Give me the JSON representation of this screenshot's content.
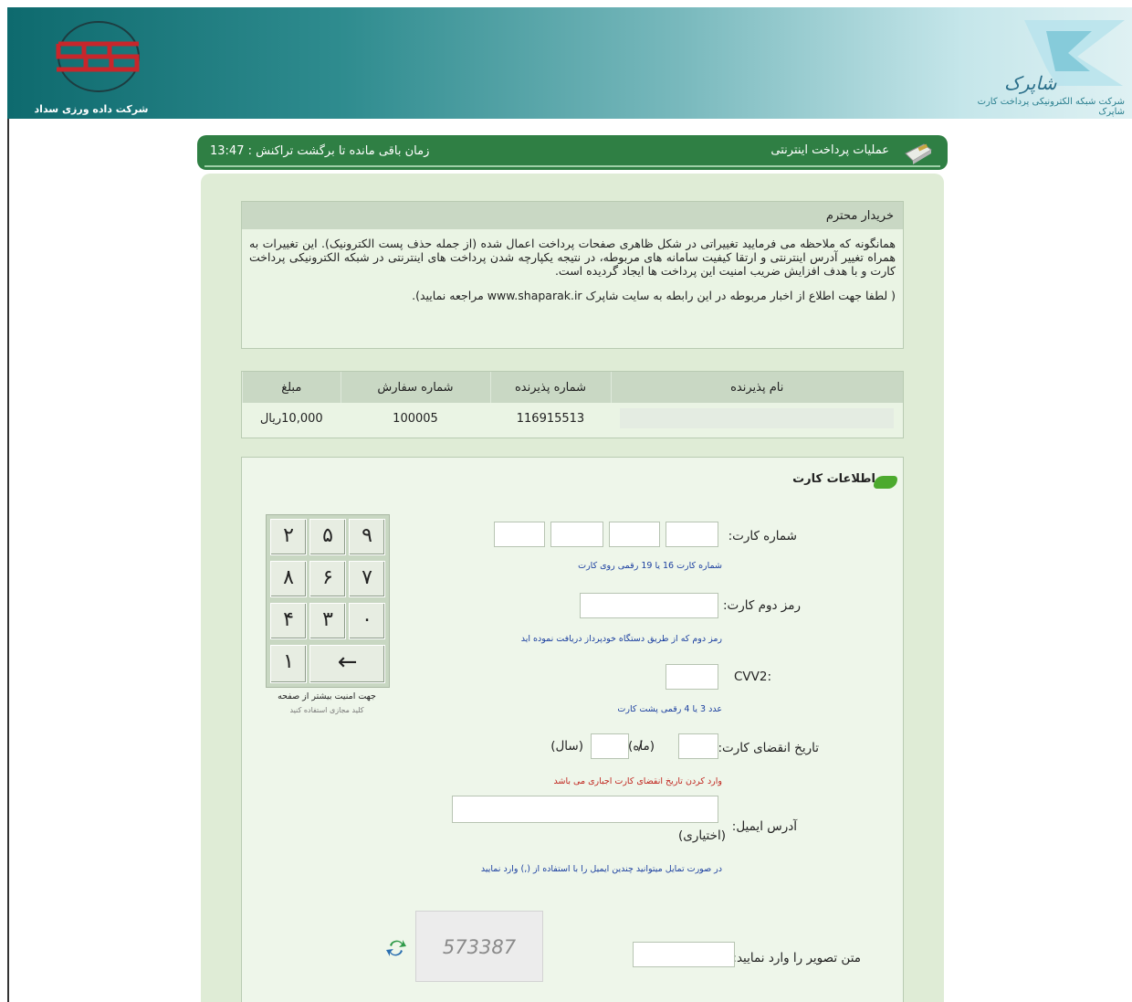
{
  "header": {
    "left_logo_text": "شرکت داده ورزی سداد",
    "right_logo_text": "شرکت شبکه الکترونیکی پرداخت کارت شاپرک",
    "right_logo_mark": "شاپرک"
  },
  "topbar": {
    "title": "عملیات پرداخت اینترنتی",
    "timer_label": "زمان باقی مانده تا برگشت تراکنش :",
    "timer_value": "13:47"
  },
  "notice": {
    "heading": "خریدار محترم",
    "body": "همانگونه که ملاحظه می فرمایید تغییراتی در شکل ظاهری صفحات پرداخت اعمال شده (از جمله حذف پست الکترونیک). این تغییرات به همراه تغییر آدرس اینترنتی و ارتقا کیفیت سامانه های مربوطه، در نتیجه یکپارچه شدن پرداخت های اینترنتی در شبکه الکترونیکی پرداخت کارت و با هدف افزایش ضریب امنیت این پرداخت ها ایجاد گردیده است.",
    "footer": "( لطفا جهت اطلاع از اخبار مربوطه در این رابطه به سایت شاپرک www.shaparak.ir مراجعه نمایید)."
  },
  "merchant": {
    "headers": [
      "نام پذیرنده",
      "شماره پذیرنده",
      "شماره سفارش",
      "مبلغ"
    ],
    "row": {
      "name": "",
      "merchant_no": "116915513",
      "order_no": "100005",
      "amount": "10,000ریال"
    }
  },
  "card_form": {
    "title": "اطلاعات کارت",
    "card_number": {
      "label": "شماره کارت:",
      "hint": "شماره کارت 16 یا 19 رقمی روی کارت"
    },
    "pin2": {
      "label": "رمز دوم کارت:",
      "hint": "رمز دوم که از طریق دستگاه خودپرداز دریافت نموده اید"
    },
    "cvv2": {
      "label": ":CVV2",
      "hint": "عدد 3 یا 4 رقمی پشت کارت"
    },
    "expiry": {
      "label": "تاریخ انقضای کارت:",
      "month_label": "(ماه)",
      "separator": "/",
      "year_label": "(سال)",
      "hint": "وارد کردن تاریخ انقضای کارت اجباری می باشد"
    },
    "email": {
      "label": "آدرس ایمیل:",
      "optional": "(اختیاری)",
      "hint": "در صورت تمایل میتوانید چندین ایمیل را با استفاده از (,) وارد نمایید"
    },
    "captcha": {
      "label": "متن تصویر را وارد نمایید:",
      "image_text": "573387"
    }
  },
  "keypad": {
    "keys": [
      "۲",
      "۵",
      "۹",
      "۸",
      "۶",
      "۷",
      "۴",
      "۳",
      "۰",
      "۱",
      "←"
    ],
    "note": "جهت امنیت بیشتر از صفحه",
    "note2": "کلید مجازی استفاده کنید"
  },
  "colors": {
    "topbar": "#2f7f44",
    "panel_bg": "#dfecd6",
    "hint_blue": "#1b3fa0",
    "hint_red": "#c0241d"
  }
}
